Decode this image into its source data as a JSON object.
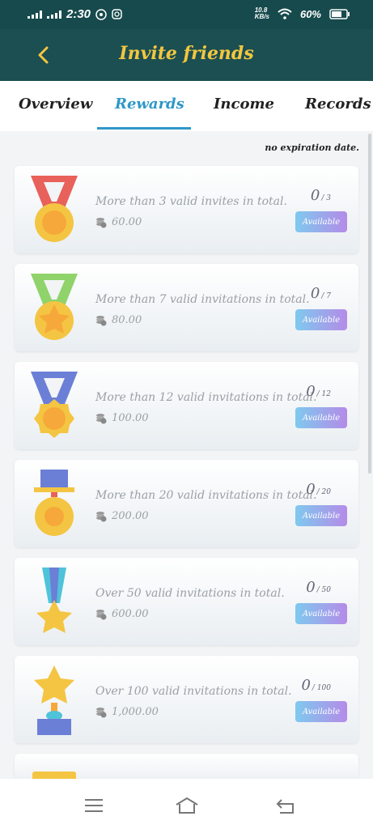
{
  "status": {
    "time": "2:30",
    "net_speed_top": "10.8",
    "net_speed_bottom": "KB/s",
    "battery": "60%"
  },
  "header": {
    "title": "Invite friends"
  },
  "tabs": [
    {
      "label": "Overview"
    },
    {
      "label": "Rewards"
    },
    {
      "label": "Income"
    },
    {
      "label": "Records"
    }
  ],
  "active_tab": "Rewards",
  "note": "no expiration date.",
  "rewards": [
    {
      "text": "More than 3 valid invites in total.",
      "amount": "60.00",
      "current": "0",
      "total": "/ 3",
      "button": "Available"
    },
    {
      "text": "More than 7 valid invitations in total.",
      "amount": "80.00",
      "current": "0",
      "total": "/ 7",
      "button": "Available"
    },
    {
      "text": "More than 12 valid invitations in total.",
      "amount": "100.00",
      "current": "0",
      "total": "/ 12",
      "button": "Available"
    },
    {
      "text": "More than 20 valid invitations in total.",
      "amount": "200.00",
      "current": "0",
      "total": "/ 20",
      "button": "Available"
    },
    {
      "text": "Over 50 valid invitations in total.",
      "amount": "600.00",
      "current": "0",
      "total": "/ 50",
      "button": "Available"
    },
    {
      "text": "Over 100 valid invitations in total.",
      "amount": "1,000.00",
      "current": "0",
      "total": "/ 100",
      "button": "Available"
    }
  ],
  "colors": {
    "header_bg": "#1b4f52",
    "title": "#f3c63f",
    "accent": "#2e97c9"
  },
  "icons": {
    "back": "chevron-left-icon",
    "coin": "coin-stack-icon",
    "menu": "menu-icon",
    "home": "home-icon",
    "back_nav": "return-icon"
  }
}
